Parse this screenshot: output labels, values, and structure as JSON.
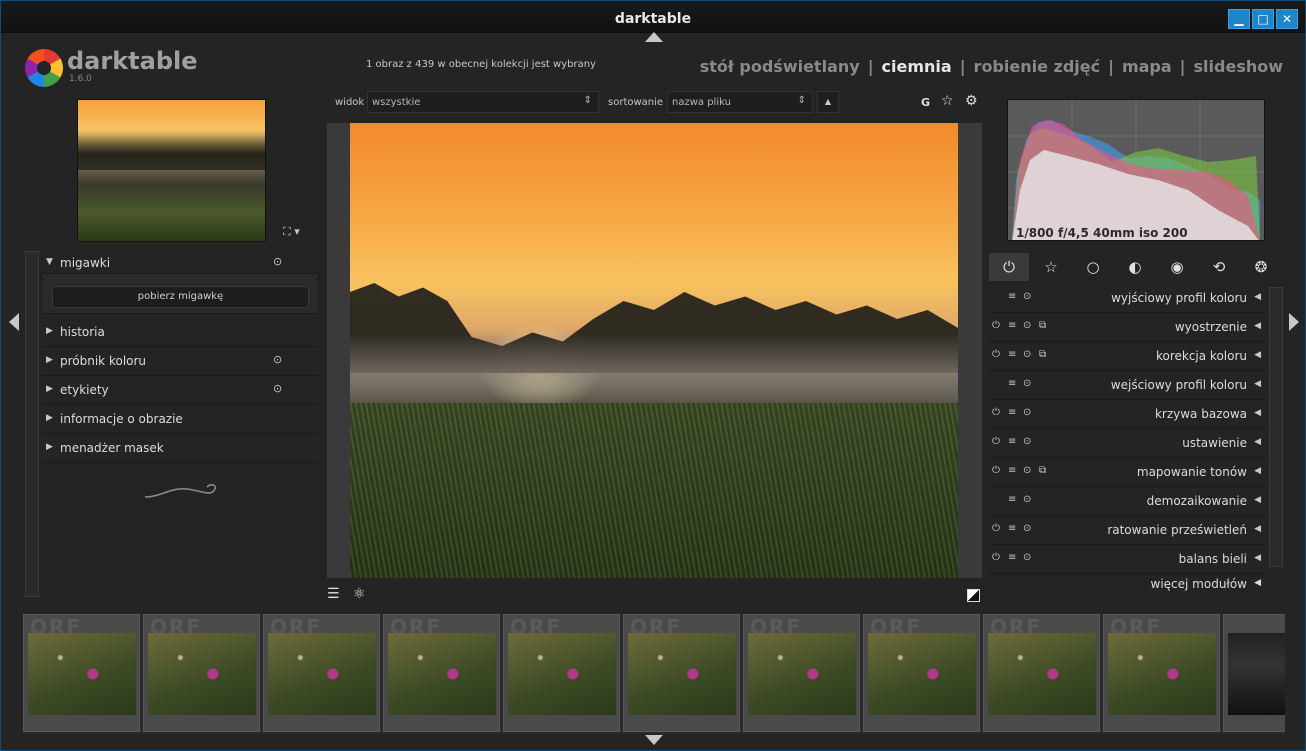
{
  "window": {
    "title": "darktable",
    "buttons": {
      "minimize": "▁",
      "maximize": "□",
      "close": "✕"
    }
  },
  "header": {
    "app_name": "darktable",
    "version": "1.6.0",
    "collection_info": "1 obraz z 439 w obecnej kolekcji jest wybrany",
    "views": [
      "stół podświetlany",
      "ciemnia",
      "robienie zdjęć",
      "mapa",
      "slideshow"
    ],
    "active_view": "ciemnia",
    "separator": "|"
  },
  "left_panel": {
    "thumb_control": "⛶ ▾",
    "modules": [
      {
        "label": "migawki",
        "expanded": true,
        "has_reset": true
      },
      {
        "label": "historia",
        "expanded": false,
        "has_reset": false
      },
      {
        "label": "próbnik koloru",
        "expanded": false,
        "has_reset": true
      },
      {
        "label": "etykiety",
        "expanded": false,
        "has_reset": true
      },
      {
        "label": "informacje o obrazie",
        "expanded": false,
        "has_reset": false
      },
      {
        "label": "menadżer masek",
        "expanded": false,
        "has_reset": false
      }
    ],
    "snapshot_button": "pobierz migawkę"
  },
  "toolbar": {
    "view_label": "widok",
    "view_value": "wszystkie",
    "sort_label": "sortowanie",
    "sort_value": "nazwa pliku",
    "sort_dir": "▲",
    "grouping": "G",
    "star_icon": "☆",
    "gear_icon": "⚙"
  },
  "center": {
    "bottom_left_icons": [
      "☰",
      "⚛"
    ]
  },
  "right_panel": {
    "exif": "1/800 f/4,5 40mm iso 200",
    "groups": [
      "⏻",
      "☆",
      "○",
      "◐",
      "◉",
      "⟲",
      "❂"
    ],
    "active_group": 0,
    "modules": [
      {
        "label": "wyjściowy profil koloru",
        "power": false,
        "presets": true,
        "reset": true,
        "multi": false
      },
      {
        "label": "wyostrzenie",
        "power": true,
        "presets": true,
        "reset": true,
        "multi": true
      },
      {
        "label": "korekcja koloru",
        "power": true,
        "presets": true,
        "reset": true,
        "multi": true
      },
      {
        "label": "wejściowy profil koloru",
        "power": false,
        "presets": true,
        "reset": true,
        "multi": false
      },
      {
        "label": "krzywa bazowa",
        "power": true,
        "presets": true,
        "reset": true,
        "multi": false
      },
      {
        "label": "ustawienie",
        "power": true,
        "presets": true,
        "reset": true,
        "multi": false
      },
      {
        "label": "mapowanie tonów",
        "power": true,
        "presets": true,
        "reset": true,
        "multi": true
      },
      {
        "label": "demozaikowanie",
        "power": false,
        "presets": true,
        "reset": true,
        "multi": false
      },
      {
        "label": "ratowanie prześwietleń",
        "power": true,
        "presets": true,
        "reset": true,
        "multi": false
      },
      {
        "label": "balans bieli",
        "power": true,
        "presets": true,
        "reset": true,
        "multi": false
      }
    ],
    "more_modules": "więcej modułów"
  },
  "filmstrip": {
    "frames": [
      {
        "ext": "ORF",
        "dark": false
      },
      {
        "ext": "ORF",
        "dark": false
      },
      {
        "ext": "ORF",
        "dark": false
      },
      {
        "ext": "ORF",
        "dark": false
      },
      {
        "ext": "ORF",
        "dark": false
      },
      {
        "ext": "ORF",
        "dark": false
      },
      {
        "ext": "ORF",
        "dark": false
      },
      {
        "ext": "ORF",
        "dark": false
      },
      {
        "ext": "ORF",
        "dark": false
      },
      {
        "ext": "ORF",
        "dark": false
      },
      {
        "ext": "",
        "dark": true
      }
    ]
  },
  "colors": {
    "accent": "#1e86c8",
    "panel": "#242424",
    "text": "#c8c8c8"
  }
}
